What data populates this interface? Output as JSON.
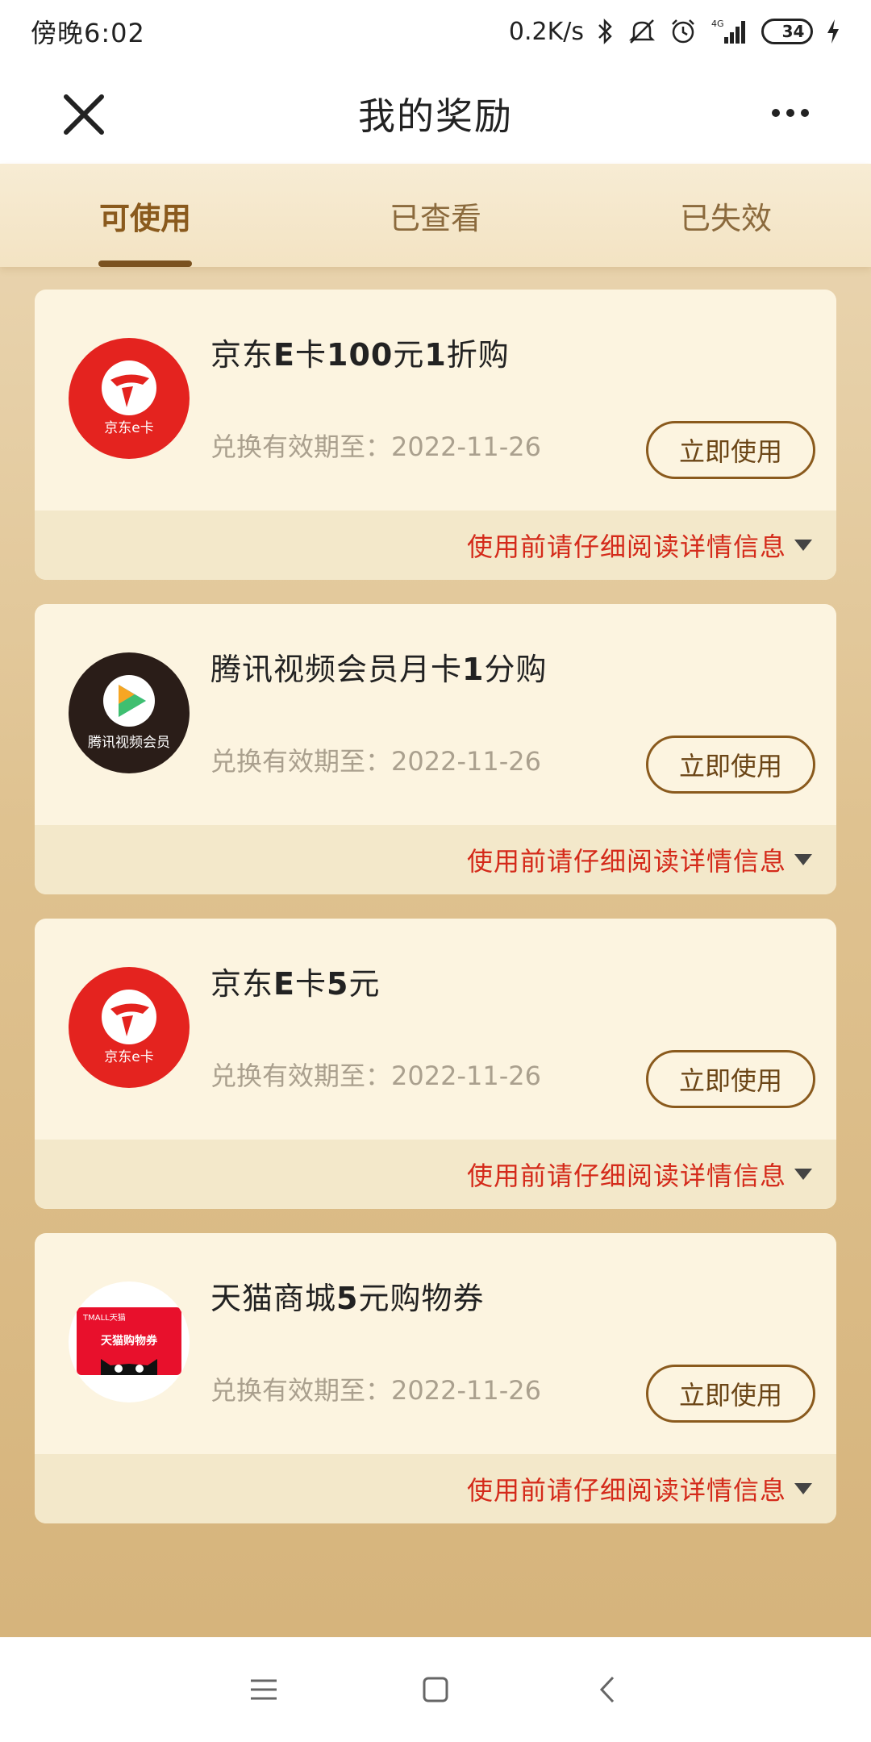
{
  "status_bar": {
    "time": "傍晚6:02",
    "network_speed": "0.2K/s",
    "signal_label": "4G",
    "battery": "34"
  },
  "nav": {
    "title": "我的奖励"
  },
  "tabs": [
    {
      "label": "可使用",
      "active": true
    },
    {
      "label": "已查看",
      "active": false
    },
    {
      "label": "已失效",
      "active": false
    }
  ],
  "cards": [
    {
      "title_parts": [
        "京东",
        "E",
        "卡",
        "100",
        "元",
        "1",
        "折购"
      ],
      "logo": "jd-ecard",
      "logo_caption": "京东e卡",
      "expiry": "兑换有效期至：2022-11-26",
      "button": "立即使用",
      "footer": "使用前请仔细阅读详情信息"
    },
    {
      "title_parts": [
        "腾讯视频会员月卡",
        "1",
        "分购"
      ],
      "logo": "tencent-video",
      "logo_caption": "腾讯视频会员",
      "expiry": "兑换有效期至：2022-11-26",
      "button": "立即使用",
      "footer": "使用前请仔细阅读详情信息"
    },
    {
      "title_parts": [
        "京东",
        "E",
        "卡",
        "5",
        "元"
      ],
      "logo": "jd-ecard",
      "logo_caption": "京东e卡",
      "expiry": "兑换有效期至：2022-11-26",
      "button": "立即使用",
      "footer": "使用前请仔细阅读详情信息"
    },
    {
      "title_parts": [
        "天猫商城",
        "5",
        "元购物券"
      ],
      "logo": "tmall",
      "logo_caption": "天猫购物券",
      "logo_header": "TMALL天猫",
      "expiry": "兑换有效期至：2022-11-26",
      "button": "立即使用",
      "footer": "使用前请仔细阅读详情信息"
    }
  ],
  "colors": {
    "accent": "#8a5a1d",
    "footer_text": "#d42a1a",
    "card_bg": "#fcf4e0",
    "jd_red": "#e4231f"
  },
  "icons": {
    "close": "close-icon",
    "more": "more-icon",
    "menu": "menu-icon",
    "home": "home-icon",
    "back": "back-icon"
  }
}
